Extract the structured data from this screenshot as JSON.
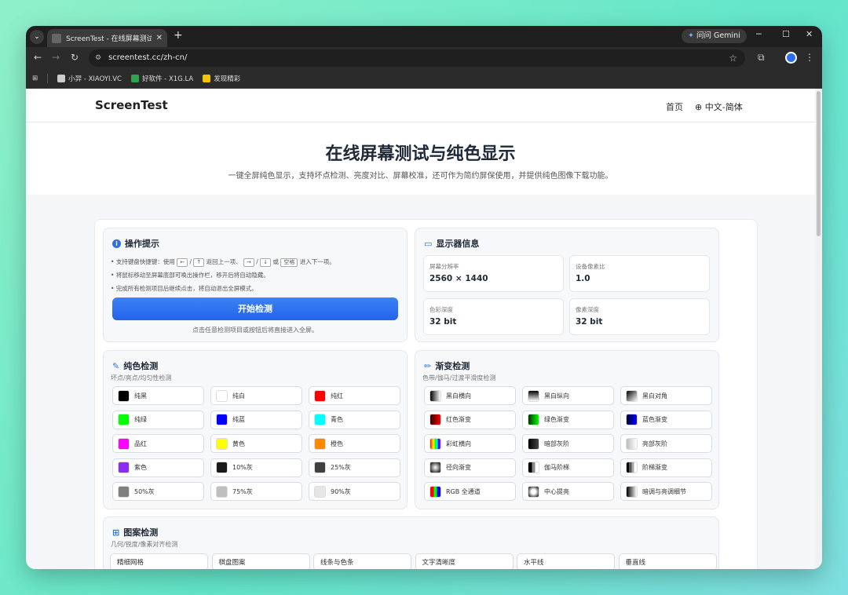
{
  "browser": {
    "tab_title": "ScreenTest - 在线屏幕测试、纯",
    "gemini": "问问 Gemini",
    "url": "screentest.cc/zh-cn/",
    "bookmarks": [
      "小羿 - XIAOYI.VC",
      "好软件 - X1G.LA",
      "发现精彩"
    ]
  },
  "site": {
    "brand": "ScreenTest",
    "nav_home": "首页",
    "lang": "中文-简体",
    "title": "在线屏幕测试与纯色显示",
    "subtitle": "一键全屏纯色显示，支持坏点检测、亮度对比、屏幕校准，还可作为简约屏保使用，并提供纯色图像下载功能。"
  },
  "tips": {
    "title": "操作提示",
    "lines": [
      "支持键盘快捷键：使用",
      "将鼠标移动至屏幕底部可唤出操作栏，移开后将自动隐藏。",
      "完成所有检测项目后继续点击，将自动退出全屏模式。"
    ],
    "kb": {
      "left": "←",
      "up": "↑",
      "back": "返回上一项、",
      "right": "→",
      "down": "↓",
      "or": "或",
      "space": "空格",
      "next": "进入下一项。"
    },
    "start": "开始检测",
    "note": "点击任意检测项目或按钮后将直接进入全屏。"
  },
  "monitor": {
    "title": "显示器信息",
    "items": [
      {
        "label": "屏幕分辨率",
        "value": "2560 × 1440"
      },
      {
        "label": "设备像素比",
        "value": "1.0"
      },
      {
        "label": "色彩深度",
        "value": "32 bit"
      },
      {
        "label": "像素深度",
        "value": "32 bit"
      }
    ]
  },
  "solid": {
    "title": "纯色检测",
    "sub": "坏点/亮点/均匀性检测",
    "items": [
      {
        "label": "纯黑",
        "color": "#000000"
      },
      {
        "label": "纯白",
        "color": "#ffffff"
      },
      {
        "label": "纯红",
        "color": "#ff0000"
      },
      {
        "label": "纯绿",
        "color": "#00ff00"
      },
      {
        "label": "纯蓝",
        "color": "#0000ff"
      },
      {
        "label": "青色",
        "color": "#00ffff"
      },
      {
        "label": "品红",
        "color": "#ff00ff"
      },
      {
        "label": "黄色",
        "color": "#ffff00"
      },
      {
        "label": "橙色",
        "color": "#ff8800"
      },
      {
        "label": "紫色",
        "color": "#8b2cf5"
      },
      {
        "label": "10%灰",
        "color": "#1a1a1a"
      },
      {
        "label": "25%灰",
        "color": "#404040"
      },
      {
        "label": "50%灰",
        "color": "#808080"
      },
      {
        "label": "75%灰",
        "color": "#bfbfbf"
      },
      {
        "label": "90%灰",
        "color": "#e6e6e6"
      }
    ]
  },
  "gradient": {
    "title": "渐变检测",
    "sub": "色带/伽马/过渡平滑度检测",
    "items": [
      "黑白横向",
      "黑白纵向",
      "黑白对角",
      "红色渐变",
      "绿色渐变",
      "蓝色渐变",
      "彩虹横向",
      "暗部灰阶",
      "亮部灰阶",
      "径向渐变",
      "伽马阶梯",
      "阶梯渐变",
      "RGB 全通道",
      "中心提亮",
      "暗调与亮调细节"
    ]
  },
  "pattern": {
    "title": "图案检测",
    "sub": "几何/锐度/像素对齐检测",
    "items": [
      "精细网格",
      "棋盘图案",
      "线条与色条",
      "文字清晰度",
      "水平线",
      "垂直线"
    ]
  }
}
